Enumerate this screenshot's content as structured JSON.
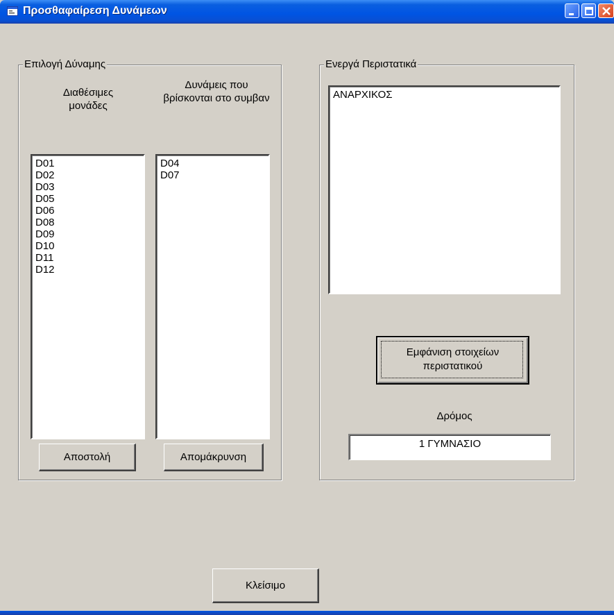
{
  "window": {
    "title": "Προσθαφαίρεση Δυνάμεων"
  },
  "force_group": {
    "legend": "Επιλογή Δύναμης",
    "available_header": "Διαθέσιμες μονάδες",
    "assigned_header": "Δυνάμεις που βρίσκονται στο συμβαν",
    "available_units": [
      "D01",
      "D02",
      "D03",
      "D05",
      "D06",
      "D08",
      "D09",
      "D10",
      "D11",
      "D12"
    ],
    "assigned_units": [
      "D04",
      "D07"
    ],
    "send_button": "Αποστολή",
    "remove_button": "Απομάκρυνση"
  },
  "incidents_group": {
    "legend": "Ενεργά Περιστατικά",
    "incidents": [
      "ΑΝΑΡΧΙΚΟΣ"
    ],
    "details_button": "Εμφάνιση στοιχείων περιστατικού",
    "street_label": "Δρόμος",
    "street_value": "1 ΓΥΜΝΑΣΙΟ"
  },
  "close_button": "Κλείσιμο",
  "icons": {
    "app": "form-window-icon",
    "minimize": "minimize-icon",
    "maximize": "maximize-icon",
    "close": "close-icon"
  }
}
